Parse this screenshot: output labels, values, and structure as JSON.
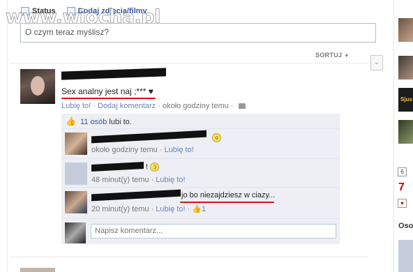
{
  "watermark": "www.wiocha.pl",
  "composer": {
    "tab_status": "Status",
    "tab_media": "Dodaj zdjęcia/filmy",
    "placeholder": "O czym teraz myślisz?"
  },
  "sort_label": "SORTUJ",
  "post": {
    "text": "Sex analny jest naj ;*** ♥",
    "like_link": "Lubię to!",
    "sep": "·",
    "comment_link": "Dodaj komentarz",
    "time": "około godziny temu"
  },
  "ufi": {
    "likes_count": "11 osób",
    "likes_suffix": "lubi to.",
    "comments": [
      {
        "text": "",
        "time": "około godziny temu",
        "like": "Lubię to!"
      },
      {
        "text": "!",
        "time": "48 minut(y) temu",
        "like": "Lubię to!"
      },
      {
        "text": "jo bo niezajdziesz w ciazy...",
        "time": "20 minut(y) temu",
        "like": "Lubię to!",
        "like_count": "1"
      }
    ],
    "write_placeholder": "Napisz komentarz..."
  },
  "sidebar": {
    "label_sjus": "Sjus",
    "calendar_day": "6",
    "big_number": "7",
    "bottom_label": "Oso"
  },
  "colors": {
    "link": "#3b5998",
    "ufi_bg": "#edeff4",
    "redline": "#dd1111"
  }
}
